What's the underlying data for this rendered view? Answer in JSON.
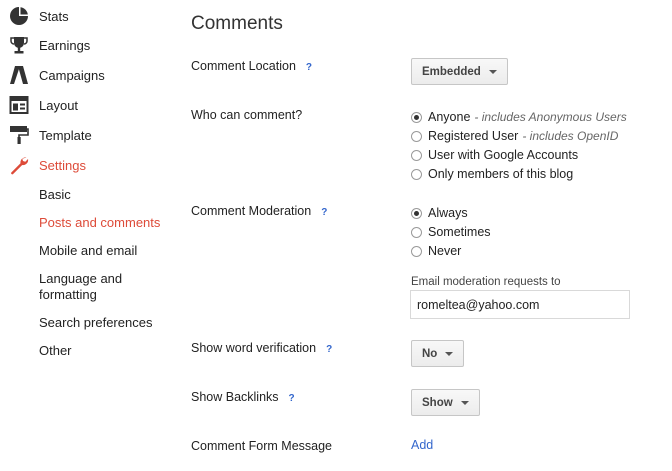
{
  "sidebar": {
    "items": [
      {
        "label": "Stats",
        "icon": "pie-chart-icon"
      },
      {
        "label": "Earnings",
        "icon": "trophy-icon"
      },
      {
        "label": "Campaigns",
        "icon": "adwords-icon"
      },
      {
        "label": "Layout",
        "icon": "layout-icon"
      },
      {
        "label": "Template",
        "icon": "paint-roller-icon"
      },
      {
        "label": "Settings",
        "icon": "wrench-icon",
        "active": true
      }
    ],
    "subitems": [
      {
        "label": "Basic"
      },
      {
        "label": "Posts and comments",
        "active": true
      },
      {
        "label": "Mobile and email"
      },
      {
        "label": "Language and formatting"
      },
      {
        "label": "Search preferences"
      },
      {
        "label": "Other"
      }
    ]
  },
  "main": {
    "title": "Comments",
    "help_symbol": "?",
    "comment_location": {
      "label": "Comment Location",
      "value": "Embedded"
    },
    "who_can_comment": {
      "label": "Who can comment?",
      "options": [
        {
          "label": "Anyone",
          "note": "- includes Anonymous Users",
          "checked": true
        },
        {
          "label": "Registered User",
          "note": "- includes OpenID",
          "checked": false
        },
        {
          "label": "User with Google Accounts",
          "note": "",
          "checked": false
        },
        {
          "label": "Only members of this blog",
          "note": "",
          "checked": false
        }
      ]
    },
    "comment_moderation": {
      "label": "Comment Moderation",
      "options": [
        {
          "label": "Always",
          "checked": true
        },
        {
          "label": "Sometimes",
          "checked": false
        },
        {
          "label": "Never",
          "checked": false
        }
      ],
      "email_label": "Email moderation requests to",
      "email_value": "romeltea@yahoo.com"
    },
    "word_verification": {
      "label": "Show word verification",
      "value": "No"
    },
    "backlinks": {
      "label": "Show Backlinks",
      "value": "Show"
    },
    "comment_form_message": {
      "label": "Comment Form Message",
      "link": "Add"
    }
  },
  "colors": {
    "accent": "#dd4b39",
    "link": "#3366cc",
    "icon": "#333333"
  }
}
